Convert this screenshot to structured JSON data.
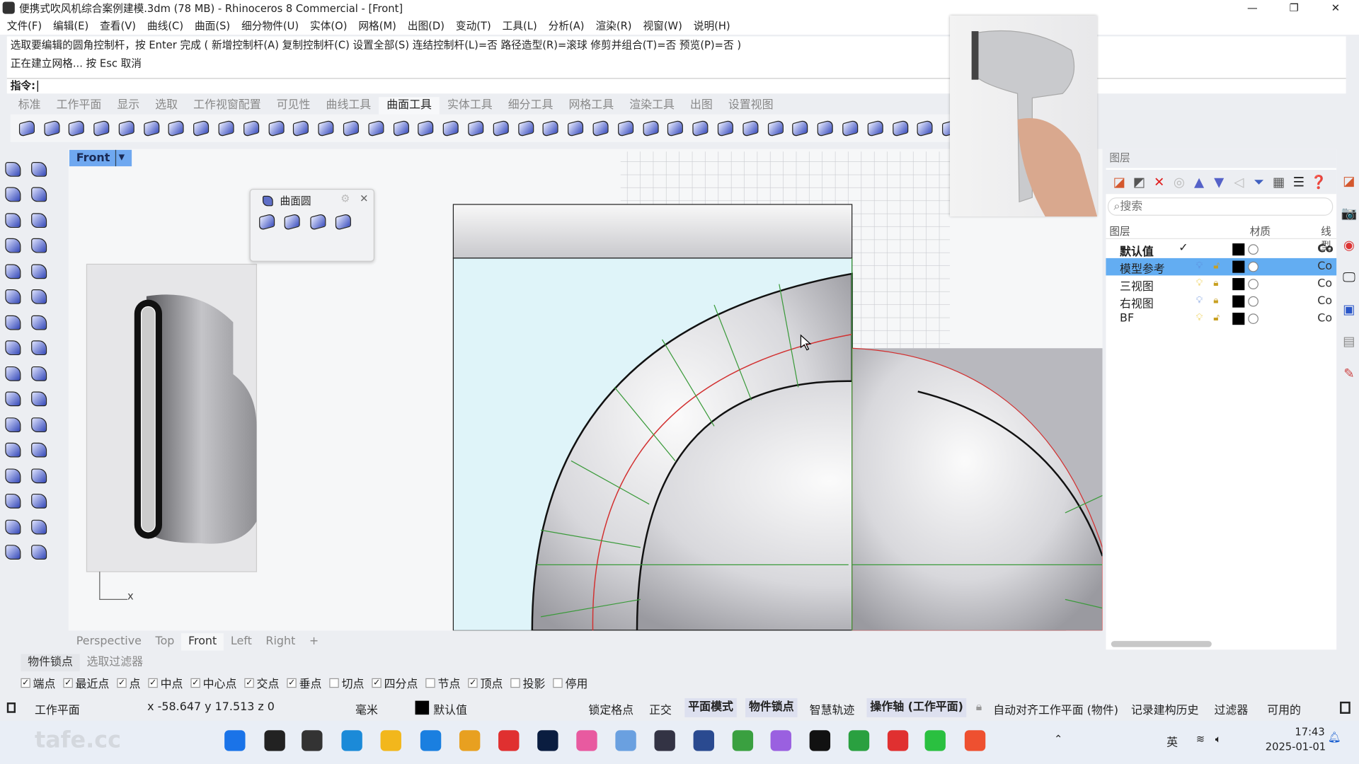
{
  "window": {
    "title": "便携式吹风机综合案例建模.3dm (78 MB) - Rhinoceros 8 Commercial - [Front]",
    "minimize": "—",
    "maximize": "❐",
    "close": "✕"
  },
  "menu": [
    "文件(F)",
    "编辑(E)",
    "查看(V)",
    "曲线(C)",
    "曲面(S)",
    "细分物件(U)",
    "实体(O)",
    "网格(M)",
    "出图(D)",
    "变动(T)",
    "工具(L)",
    "分析(A)",
    "渲染(R)",
    "视窗(W)",
    "说明(H)"
  ],
  "command": {
    "history": [
      "选取要编辑的圆角控制杆，按 Enter 完成 ( 新增控制杆(A)  复制控制杆(C)  设置全部(S)  连结控制杆(L)=否  路径造型(R)=滚球  修剪并组合(T)=否  预览(P)=否 )",
      "正在建立网格... 按 Esc 取消"
    ],
    "prompt": "指令:",
    "value": ""
  },
  "toolbar_tabs": {
    "items": [
      "标准",
      "工作平面",
      "显示",
      "选取",
      "工作视窗配置",
      "可见性",
      "曲线工具",
      "曲面工具",
      "实体工具",
      "细分工具",
      "网格工具",
      "渲染工具",
      "出图",
      "设置视图"
    ],
    "active": "曲面工具"
  },
  "toolbar_icons": [
    "surface-from-3-points",
    "surface-from-edges",
    "loft",
    "sweep-1-rail",
    "fillet-surface",
    "revolve",
    "rail-revolve",
    "plane",
    "extrude",
    "blend-surface",
    "match-surface",
    "merge-surface",
    "rebuild",
    "offset-surface",
    "arc-blend",
    "patch",
    "network-surface",
    "unroll",
    "adjust-seam",
    "fit",
    "change-degree",
    "extend-surface",
    "shrink-trimmed",
    "control-points-on",
    "edit-points",
    "uvn-move",
    "cage-edit",
    "point-grid",
    "flow-along-surface",
    "sphere-morph",
    "cylinder",
    "pyramid",
    "bend",
    "twist",
    "splop",
    "flow",
    "unfold",
    "rhino-render"
  ],
  "viewport": {
    "name": "Front",
    "axis_label": "x",
    "tabs": [
      "Perspective",
      "Top",
      "Front",
      "Left",
      "Right"
    ],
    "active_tab": "Front",
    "add_tab": "+"
  },
  "left_toolbar_icons": [
    "select",
    "point",
    "polyline",
    "line",
    "curve-from-points",
    "arc",
    "rectangle",
    "circle",
    "ellipse",
    "polygon",
    "surface-edge",
    "extrude-curve",
    "box",
    "sphere",
    "cylinder",
    "cone",
    "fillet-edge",
    "boolean-union",
    "move",
    "rotate",
    "scale",
    "mirror",
    "array",
    "group",
    "trim",
    "split",
    "join",
    "explode",
    "dimension",
    "text",
    "layer",
    "grid"
  ],
  "floating_toolbar": {
    "title": "曲面圆",
    "icons": [
      "surface-from-3-points",
      "surface-from-edges",
      "loft",
      "sweep"
    ]
  },
  "layers": {
    "panel_title": "图层",
    "search_placeholder": "搜索",
    "columns": {
      "name": "图层",
      "material": "材质",
      "linetype": "线型"
    },
    "rows": [
      {
        "name": "默认值",
        "current": true,
        "linetype": "Co"
      },
      {
        "name": "模型参考",
        "selected": true,
        "linetype": "Co"
      },
      {
        "name": "三视图",
        "linetype": "Co"
      },
      {
        "name": "右视图",
        "linetype": "Co"
      },
      {
        "name": "BF",
        "linetype": "Co"
      }
    ],
    "current_mark": "✓"
  },
  "osnap": {
    "tabs": [
      "物件锁点",
      "选取过滤器"
    ],
    "items": [
      {
        "label": "端点",
        "checked": true
      },
      {
        "label": "最近点",
        "checked": true
      },
      {
        "label": "点",
        "checked": true
      },
      {
        "label": "中点",
        "checked": true
      },
      {
        "label": "中心点",
        "checked": true
      },
      {
        "label": "交点",
        "checked": true
      },
      {
        "label": "垂点",
        "checked": true
      },
      {
        "label": "切点",
        "checked": false
      },
      {
        "label": "四分点",
        "checked": true
      },
      {
        "label": "节点",
        "checked": false
      },
      {
        "label": "顶点",
        "checked": true
      },
      {
        "label": "投影",
        "checked": false
      },
      {
        "label": "停用",
        "checked": false
      }
    ]
  },
  "status": {
    "cplane": "工作平面",
    "coords": "x -58.647  y 17.513  z 0",
    "units": "毫米",
    "layer": "默认值",
    "grid_snap": "锁定格点",
    "ortho": "正交",
    "planar": "平面模式",
    "osnap": "物件锁点",
    "smarttrack": "智慧轨迹",
    "gumball": "操作轴 (工作平面)",
    "autocplane": "自动对齐工作平面 (物件)",
    "history": "记录建构历史",
    "filter": "过滤器",
    "available": "可用的"
  },
  "taskbar": {
    "clock_time": "17:43",
    "clock_date": "2025-01-01",
    "ime": "英",
    "watermark": "tafe.cc"
  },
  "colors": {
    "accent": "#63adf2",
    "viewport_label": "#6fa8f0",
    "curve_red": "#d23030",
    "isocurve_green": "#3a9a3a"
  }
}
